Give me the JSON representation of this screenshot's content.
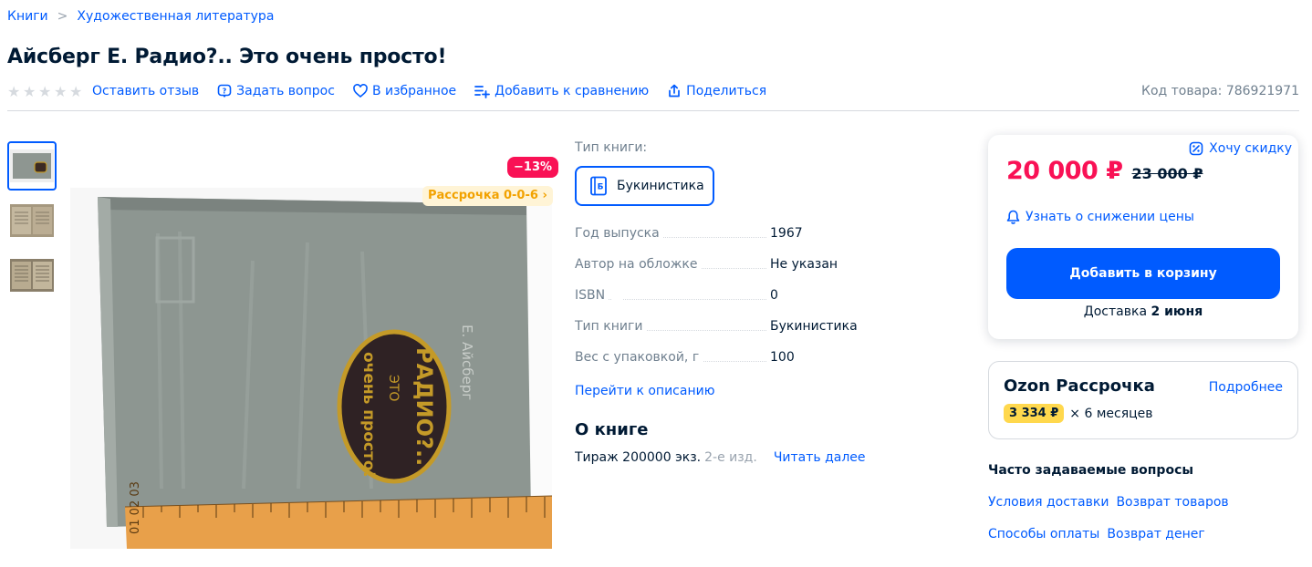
{
  "breadcrumb": {
    "items": [
      "Книги",
      "Художественная литература"
    ],
    "separator": ">"
  },
  "product": {
    "title": "Айсберг Е. Радио?.. Это очень просто!",
    "sku_label": "Код товара: 786921971"
  },
  "actions": {
    "leave_review": "Оставить отзыв",
    "ask_question": "Задать вопрос",
    "favorite": "В избранное",
    "compare": "Добавить к сравнению",
    "share": "Поделиться"
  },
  "gallery": {
    "discount_badge": "−13%",
    "installment_badge": "Рассрочка 0-0-6 ›",
    "thumbnail_count": 3
  },
  "specs": {
    "type_label": "Тип книги:",
    "type_chip": "Букинистика",
    "rows": [
      {
        "key": "Год выпуска",
        "value": "1967"
      },
      {
        "key": "Автор на обложке",
        "value": "Не указан"
      },
      {
        "key": "ISBN",
        "value": "0"
      },
      {
        "key": "Тип книги",
        "value": "Букинистика"
      },
      {
        "key": "Вес с упаковкой, г",
        "value": "100"
      }
    ],
    "go_to_description": "Перейти к описанию"
  },
  "about": {
    "title": "О книге",
    "text": "Тираж 200000 экз.",
    "fade": "2-е изд.",
    "read_more": "Читать далее"
  },
  "price_card": {
    "want_discount": "Хочу скидку",
    "price": "20 000 ₽",
    "old_price": "23 000 ₽",
    "price_alert": "Узнать о снижении цены",
    "add_to_cart": "Добавить в корзину",
    "delivery_prefix": "Доставка",
    "delivery_date": "2 июня"
  },
  "installment": {
    "title": "Ozon Рассрочка",
    "more": "Подробнее",
    "amount": "3 334 ₽",
    "months": "× 6 месяцев"
  },
  "faq": {
    "title": "Часто задаваемые вопросы",
    "links_row1": [
      "Условия доставки",
      "Возврат товаров"
    ],
    "links_row2": [
      "Способы оплаты",
      "Возврат денег"
    ]
  },
  "colors": {
    "accent": "#005bff",
    "price": "#f91155",
    "installment_chip": "#ffd84d"
  }
}
